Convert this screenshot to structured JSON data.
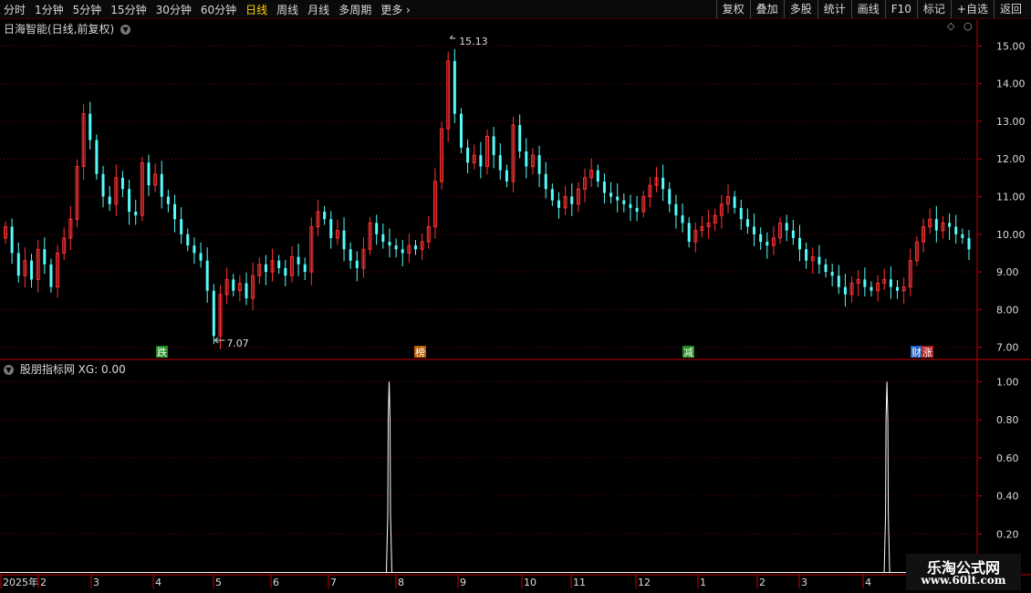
{
  "toolbar": {
    "periods": [
      "分时",
      "1分钟",
      "5分钟",
      "15分钟",
      "30分钟",
      "60分钟",
      "日线",
      "周线",
      "月线",
      "多周期",
      "更多"
    ],
    "active_period": "日线",
    "actions": [
      "复权",
      "叠加",
      "多股",
      "统计",
      "画线",
      "F10",
      "标记",
      "+自选",
      "返回"
    ]
  },
  "main_panel": {
    "title": "日海智能(日线,前复权)",
    "high_label": "15.13",
    "low_label": "7.07",
    "markers": [
      "跌",
      "榜",
      "减",
      "财",
      "涨"
    ]
  },
  "indicator_panel": {
    "title": "股朋指标网 XG: 0.00"
  },
  "colors": {
    "up": "#ff3232",
    "down": "#54fcfc",
    "grid": "#7a0000",
    "axis": "#c80000",
    "indicator": "#ffffff"
  },
  "chart_data": [
    {
      "type": "candlestick",
      "y_ticks": [
        "15.00",
        "14.00",
        "13.00",
        "12.00",
        "11.00",
        "10.00",
        "9.00",
        "8.00",
        "7.00"
      ],
      "ylim": [
        6.7,
        15.3
      ],
      "x_labels": [
        "2025年",
        "2",
        "3",
        "4",
        "5",
        "6",
        "7",
        "8",
        "9",
        "10",
        "11",
        "12",
        "1",
        "2",
        "3",
        "4"
      ],
      "close": [
        10.2,
        9.5,
        8.9,
        9.3,
        8.8,
        9.6,
        9.2,
        8.6,
        9.5,
        9.9,
        10.4,
        11.8,
        13.2,
        12.5,
        11.6,
        11.0,
        10.8,
        11.5,
        11.2,
        10.6,
        10.5,
        11.9,
        11.3,
        11.6,
        11.0,
        10.8,
        10.4,
        10.0,
        9.7,
        9.5,
        9.3,
        8.5,
        7.3,
        8.4,
        8.8,
        8.5,
        8.7,
        8.3,
        8.9,
        9.2,
        9.0,
        9.3,
        9.1,
        8.9,
        9.4,
        9.2,
        9.0,
        10.2,
        10.6,
        10.4,
        9.9,
        10.1,
        9.6,
        9.3,
        9.1,
        9.6,
        10.3,
        10.0,
        9.8,
        9.7,
        9.6,
        9.5,
        9.7,
        9.6,
        9.8,
        10.2,
        11.4,
        12.8,
        14.6,
        13.2,
        12.3,
        11.9,
        12.1,
        11.8,
        12.6,
        12.1,
        11.7,
        11.4,
        12.9,
        12.2,
        11.8,
        12.1,
        11.6,
        11.2,
        10.9,
        10.7,
        11.0,
        10.8,
        11.2,
        11.5,
        11.7,
        11.4,
        11.1,
        11.0,
        10.9,
        10.8,
        10.7,
        10.6,
        11.0,
        11.3,
        11.5,
        11.2,
        10.8,
        10.5,
        10.3,
        9.8,
        10.1,
        10.2,
        10.3,
        10.5,
        10.8,
        11.0,
        10.7,
        10.4,
        10.2,
        10.0,
        9.8,
        9.7,
        9.9,
        10.3,
        10.1,
        9.9,
        9.6,
        9.3,
        9.4,
        9.2,
        9.0,
        8.9,
        8.6,
        8.4,
        8.7,
        8.8,
        8.6,
        8.5,
        8.7,
        8.8,
        8.6,
        8.5,
        8.6,
        9.3,
        9.8,
        10.2,
        10.4,
        10.1,
        10.3,
        10.2,
        10.0,
        9.9,
        9.6
      ]
    },
    {
      "type": "line",
      "y_ticks": [
        "1.00",
        "0.80",
        "0.60",
        "0.40",
        "0.20"
      ],
      "ylim": [
        0,
        1.05
      ],
      "signal_positions": [
        0.3986,
        0.9085
      ],
      "signal_value": 1.0
    }
  ]
}
